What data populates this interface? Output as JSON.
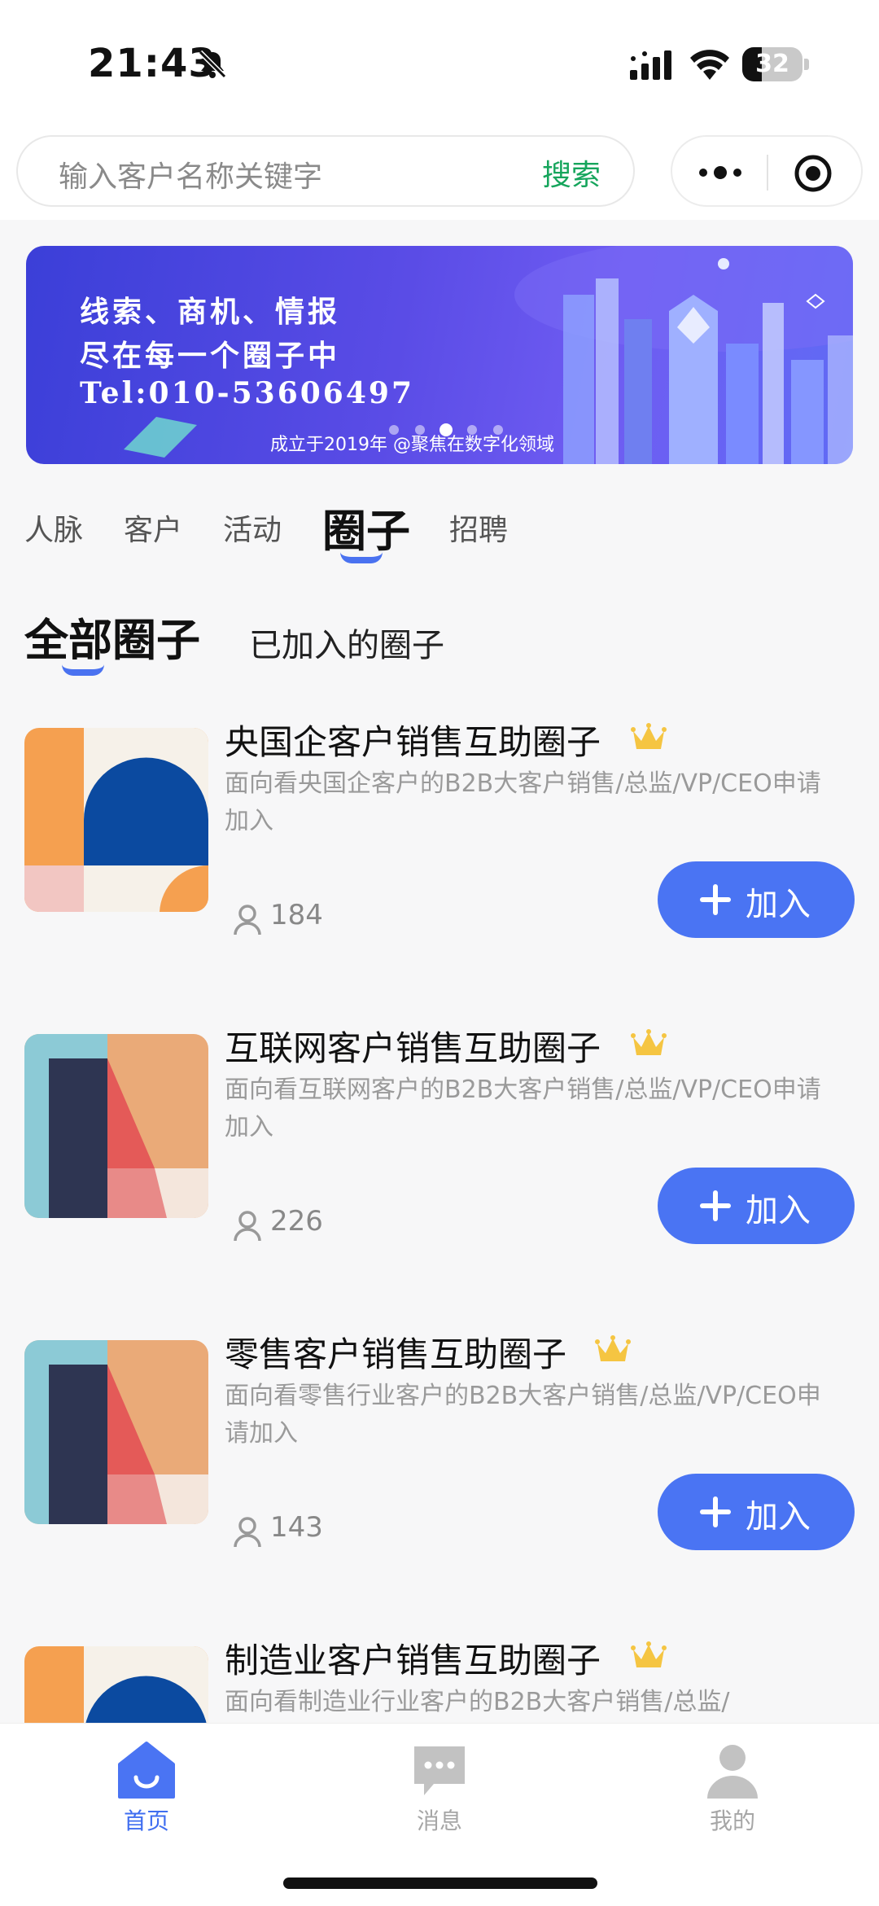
{
  "status_bar": {
    "time": "21:43",
    "battery": "32",
    "battery_level": 0.32
  },
  "search": {
    "placeholder": "输入客户名称关键字",
    "button_label": "搜索"
  },
  "banner": {
    "line1": "线索、商机、情报",
    "line2": "尽在每一个圈子中",
    "line3": "Tel:010-53606497",
    "caption": "成立于2019年 @聚焦在数字化领域"
  },
  "main_tabs": [
    {
      "label": "人脉"
    },
    {
      "label": "客户"
    },
    {
      "label": "活动"
    },
    {
      "label": "圈子",
      "active": true
    },
    {
      "label": "招聘"
    }
  ],
  "sub_tabs": [
    {
      "label": "全部圈子",
      "active": true
    },
    {
      "label": "已加入的圈子"
    }
  ],
  "circles": [
    {
      "title": "央国企客户销售互助圈子",
      "desc": "面向看央国企客户的B2B大客户销售/总监/VP/CEO申请加入",
      "members": "184",
      "join_label": "加入",
      "thumb_icon": "orange-navy-pattern-thumbnail"
    },
    {
      "title": "互联网客户销售互助圈子",
      "desc": "面向看互联网客户的B2B大客户销售/总监/VP/CEO申请加入",
      "members": "226",
      "join_label": "加入",
      "thumb_icon": "teal-navy-red-pattern-thumbnail"
    },
    {
      "title": "零售客户销售互助圈子",
      "desc": "面向看零售行业客户的B2B大客户销售/总监/VP/CEO申请加入",
      "members": "143",
      "join_label": "加入",
      "thumb_icon": "teal-navy-red-pattern-thumbnail"
    },
    {
      "title": "制造业客户销售互助圈子",
      "desc": "面向看制造业行业客户的B2B大客户销售/总监/",
      "thumb_icon": "orange-navy-pattern-thumbnail"
    }
  ],
  "bottom_nav": [
    {
      "label": "首页",
      "icon": "home-icon",
      "active": true
    },
    {
      "label": "消息",
      "icon": "message-icon"
    },
    {
      "label": "我的",
      "icon": "user-icon"
    }
  ],
  "colors": {
    "accent": "#4a74f3",
    "search_green": "#16a55c",
    "crown": "#f5c542"
  }
}
